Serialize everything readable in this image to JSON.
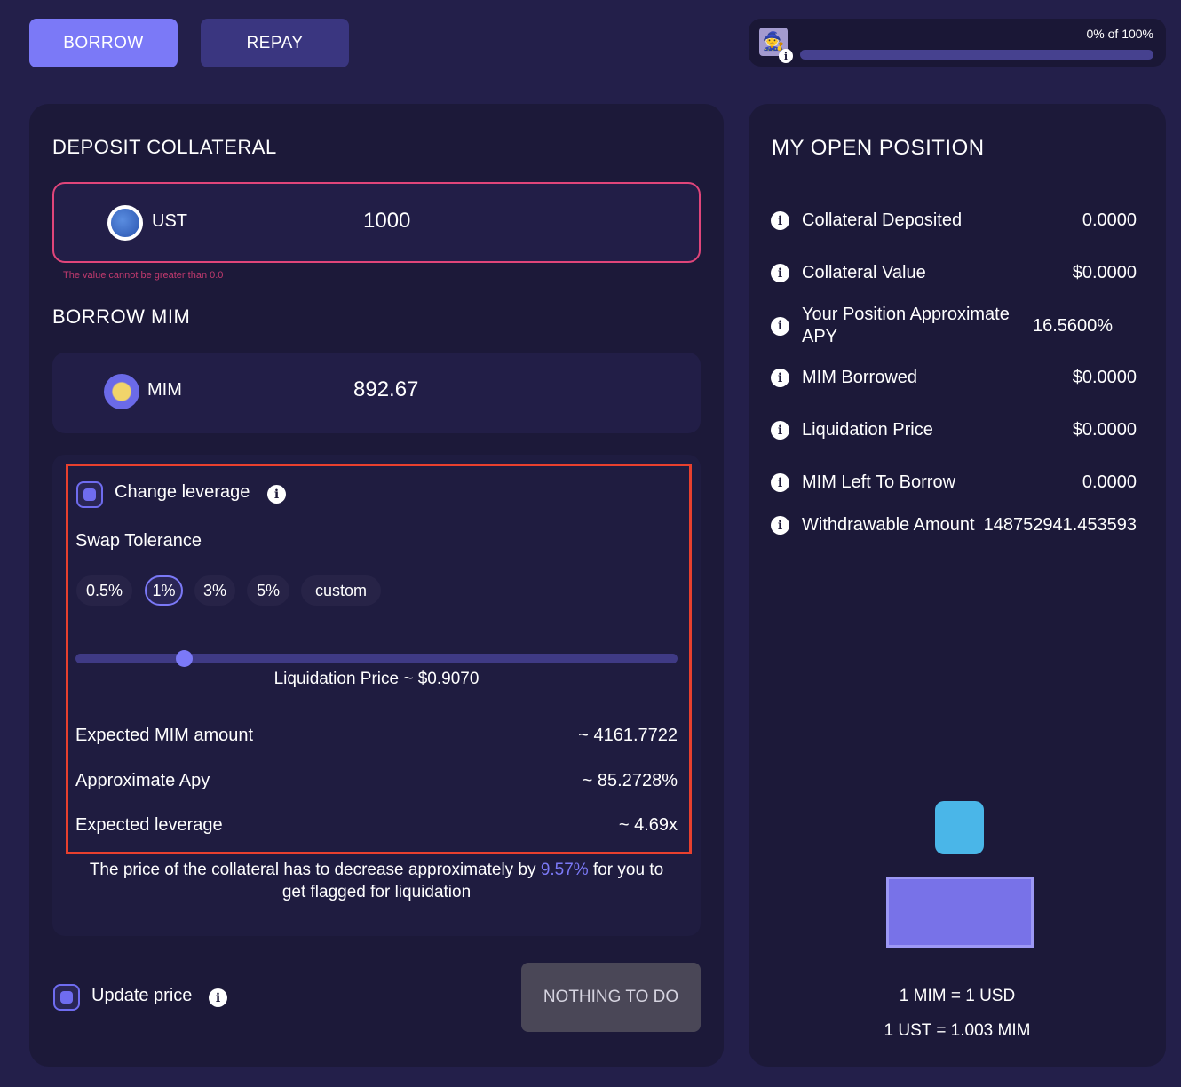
{
  "tabs": {
    "borrow": "BORROW",
    "repay": "REPAY"
  },
  "progress": {
    "label": "0% of 100%",
    "value_percent": 0
  },
  "deposit": {
    "title": "DEPOSIT COLLATERAL",
    "token": "UST",
    "amount": "1000",
    "error": "The value cannot be greater than 0.0"
  },
  "borrow": {
    "title": "BORROW MIM",
    "token": "MIM",
    "amount": "892.67"
  },
  "leverage": {
    "checkbox_label": "Change leverage",
    "swap_tolerance": "Swap Tolerance",
    "options": [
      "0.5%",
      "1%",
      "3%",
      "5%",
      "custom"
    ],
    "selected": "1%",
    "slider_value_fraction": 0.18,
    "liquidation_price": "Liquidation Price ~ $0.9070",
    "stats": [
      {
        "label": "Expected MIM amount",
        "value": "~ 4161.7722"
      },
      {
        "label": "Approximate Apy",
        "value": "~ 85.2728%"
      },
      {
        "label": "Expected leverage",
        "value": "~ 4.69x"
      }
    ],
    "note_pre": "The price of the collateral has to decrease approximately by ",
    "note_pct": "9.57%",
    "note_post": " for you to get flagged for liquidation"
  },
  "update_price": "Update price",
  "action": "NOTHING TO DO",
  "position": {
    "title": "MY OPEN POSITION",
    "rows": [
      {
        "label": "Collateral Deposited",
        "value": "0.0000"
      },
      {
        "label": "Collateral Value",
        "value": "$0.0000"
      },
      {
        "label": "Your Position Approximate APY",
        "value": "16.5600%"
      },
      {
        "label": "MIM Borrowed",
        "value": "$0.0000"
      },
      {
        "label": "Liquidation Price",
        "value": "$0.0000"
      },
      {
        "label": "MIM Left To Borrow",
        "value": "0.0000"
      },
      {
        "label": "Withdrawable Amount",
        "value": "148752941.453593"
      }
    ],
    "rate1": "1 MIM = 1 USD",
    "rate2": "1 UST = 1.003 MIM"
  },
  "colors": {
    "accent": "#7b79f7",
    "error": "#e0457a",
    "highlight": "#e8402e"
  }
}
